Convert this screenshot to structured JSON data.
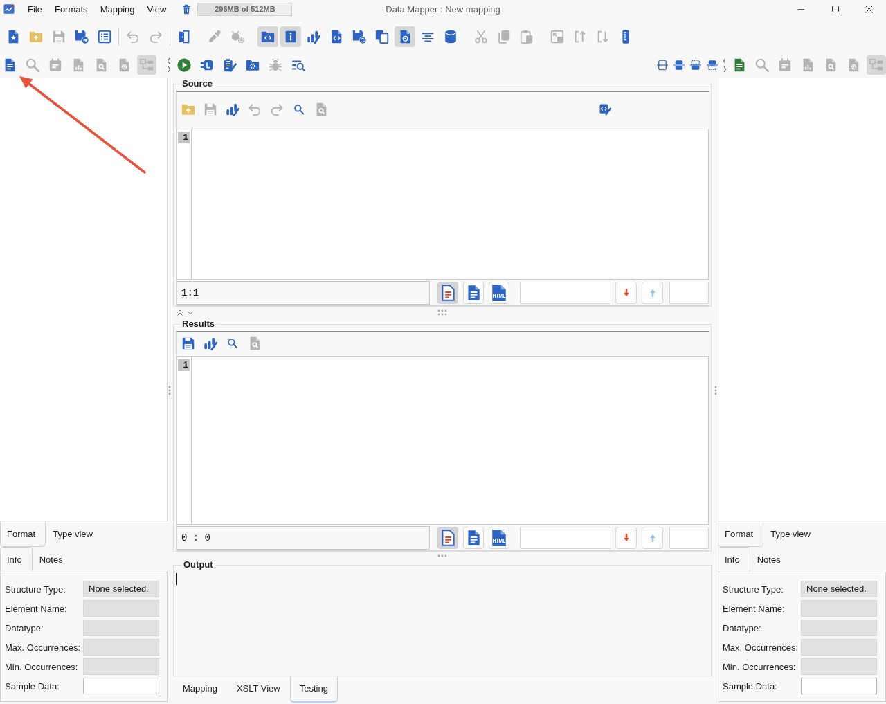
{
  "window": {
    "title": "Data Mapper : New mapping"
  },
  "menu": [
    {
      "label": "File"
    },
    {
      "label": "Formats"
    },
    {
      "label": "Mapping"
    },
    {
      "label": "View"
    }
  ],
  "memory": {
    "label": "296MB of 512MB",
    "level": 0.58
  },
  "main_toolbar": [
    {
      "divider": false,
      "buttons": [
        {
          "disabled": false,
          "on": false
        },
        {
          "disabled": false,
          "on": false
        },
        {
          "disabled": true,
          "on": false
        },
        {
          "disabled": false,
          "on": false
        },
        {
          "disabled": false,
          "on": false
        }
      ]
    },
    {
      "divider": true,
      "buttons": [
        {
          "disabled": true,
          "on": false
        },
        {
          "disabled": true,
          "on": false
        }
      ]
    },
    {
      "divider": true,
      "buttons": [
        {
          "disabled": false,
          "on": false
        }
      ]
    },
    {
      "divider": false,
      "buttons": [
        {
          "disabled": true,
          "on": false
        },
        {
          "disabled": true,
          "on": false
        }
      ]
    },
    {
      "divider": false,
      "buttons": [
        {
          "disabled": false,
          "on": true
        },
        {
          "disabled": false,
          "on": true
        },
        {
          "disabled": false,
          "on": false
        },
        {
          "disabled": false,
          "on": false
        },
        {
          "disabled": false,
          "on": false
        },
        {
          "disabled": false,
          "on": false
        },
        {
          "disabled": false,
          "on": true
        },
        {
          "disabled": false,
          "on": false
        },
        {
          "disabled": false,
          "on": false
        }
      ]
    },
    {
      "divider": false,
      "buttons": [
        {
          "disabled": true,
          "on": false
        },
        {
          "disabled": true,
          "on": false
        },
        {
          "disabled": true,
          "on": false
        }
      ]
    },
    {
      "divider": false,
      "buttons": [
        {
          "disabled": true,
          "on": false
        },
        {
          "disabled": true,
          "on": false
        },
        {
          "disabled": true,
          "on": false
        },
        {
          "disabled": false,
          "on": false
        }
      ]
    }
  ],
  "left_toolbar": [
    {
      "disabled": false,
      "on": false
    },
    {
      "disabled": true,
      "on": false
    },
    {
      "disabled": true,
      "on": false
    },
    {
      "disabled": true,
      "on": false
    },
    {
      "disabled": true,
      "on": false
    },
    {
      "disabled": true,
      "on": false
    },
    {
      "disabled": true,
      "on": true
    }
  ],
  "run_toolbar": [
    {
      "disabled": false
    },
    {
      "disabled": false
    },
    {
      "disabled": false
    },
    {
      "disabled": false
    },
    {
      "disabled": true
    },
    {
      "disabled": false
    }
  ],
  "right_toolbar": [
    {
      "disabled": false,
      "on": false
    },
    {
      "disabled": true,
      "on": false
    },
    {
      "disabled": true,
      "on": false
    },
    {
      "disabled": true,
      "on": false
    },
    {
      "disabled": true,
      "on": false
    },
    {
      "disabled": true,
      "on": false
    },
    {
      "disabled": true,
      "on": true
    }
  ],
  "left_panel": {
    "tabs": [
      {
        "label": "Format",
        "selected": true
      },
      {
        "label": "Type view",
        "selected": false
      }
    ],
    "info_tabs": [
      {
        "label": "Info",
        "selected": true
      },
      {
        "label": "Notes",
        "selected": false
      }
    ],
    "fields": [
      {
        "label": "Structure Type:",
        "value": "None selected.",
        "disabled": true
      },
      {
        "label": "Element Name:",
        "disabled": true
      },
      {
        "label": "Datatype:",
        "disabled": true
      },
      {
        "label": "Max. Occurrences:",
        "disabled": true
      },
      {
        "label": "Min. Occurrences:",
        "disabled": true
      },
      {
        "label": "Sample Data:",
        "disabled": false
      }
    ]
  },
  "source": {
    "title": "Source",
    "tools": [
      {
        "disabled": false
      },
      {
        "disabled": true
      },
      {
        "disabled": false
      },
      {
        "disabled": true
      },
      {
        "disabled": true
      },
      {
        "disabled": false
      },
      {
        "disabled": true
      }
    ],
    "line_numbers": [
      "1"
    ],
    "position": "1:1",
    "format_buttons": [
      {
        "kind": "text",
        "selected": true
      },
      {
        "kind": "document",
        "selected": false
      },
      {
        "kind": "html",
        "selected": false,
        "badge": "HTML"
      }
    ],
    "nav_buttons": [
      {
        "kind": "down",
        "disabled": false
      },
      {
        "kind": "up",
        "disabled": true
      }
    ]
  },
  "results": {
    "title": "Results",
    "tools": [
      {
        "disabled": false
      },
      {
        "disabled": false
      },
      {
        "disabled": false
      },
      {
        "disabled": true
      }
    ],
    "line_numbers": [
      "1"
    ],
    "position": "0 : 0",
    "format_buttons": [
      {
        "kind": "text",
        "selected": true
      },
      {
        "kind": "document",
        "selected": false
      },
      {
        "kind": "html",
        "selected": false,
        "badge": "HTML"
      }
    ],
    "nav_buttons": [
      {
        "kind": "down",
        "disabled": false
      },
      {
        "kind": "up",
        "disabled": true
      }
    ]
  },
  "output": {
    "title": "Output"
  },
  "bottom_tabs": [
    {
      "label": "Mapping",
      "selected": false
    },
    {
      "label": "XSLT View",
      "selected": false
    },
    {
      "label": "Testing",
      "selected": true
    }
  ],
  "right_panel": {
    "tabs": [
      {
        "label": "Format",
        "selected": true
      },
      {
        "label": "Type view",
        "selected": false
      }
    ],
    "info_tabs": [
      {
        "label": "Info",
        "selected": true
      },
      {
        "label": "Notes",
        "selected": false
      }
    ],
    "fields": [
      {
        "label": "Structure Type:",
        "value": "None selected.",
        "disabled": true
      },
      {
        "label": "Element Name:",
        "disabled": true
      },
      {
        "label": "Datatype:",
        "disabled": true
      },
      {
        "label": "Max. Occurrences:",
        "disabled": true
      },
      {
        "label": "Min. Occurrences:",
        "disabled": true
      },
      {
        "label": "Sample Data:",
        "disabled": false
      }
    ]
  }
}
